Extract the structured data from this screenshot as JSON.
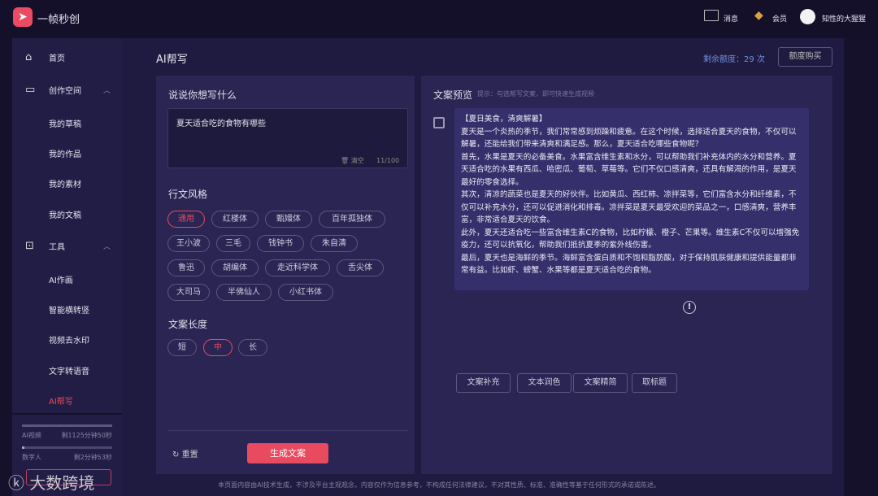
{
  "app": {
    "name": "一帧秒创",
    "logo_icon": "play-arrow-icon"
  },
  "topbar": {
    "messages": "消息",
    "member": "会员",
    "username": "知性的大猩猩"
  },
  "sidebar": {
    "items": [
      {
        "label": "首页"
      },
      {
        "label": "创作空间"
      },
      {
        "label": "我的草稿"
      },
      {
        "label": "我的作品"
      },
      {
        "label": "我的素材"
      },
      {
        "label": "我的文稿"
      },
      {
        "label": "工具"
      },
      {
        "label": "AI作画"
      },
      {
        "label": "智能横转竖"
      },
      {
        "label": "视频去水印"
      },
      {
        "label": "文字转语音"
      },
      {
        "label": "AI帮写"
      }
    ],
    "quota": [
      {
        "label": "AI视频",
        "value": "剩1125分钟50秒",
        "fill": 1.0
      },
      {
        "label": "数字人",
        "value": "剩2分钟53秒",
        "fill": 0.03
      }
    ]
  },
  "watermark": "大数跨境",
  "page": {
    "title": "AI帮写",
    "remaining": "剩余额度：29 次",
    "buy": "额度购买"
  },
  "left": {
    "prompt_title": "说说你想写什么",
    "prompt_value": "夏天适合吃的食物有哪些",
    "clear": "清空",
    "count": "11/100",
    "style_title": "行文风格",
    "styles": [
      "通用",
      "红楼体",
      "甄嬛体",
      "百年孤独体",
      "王小波",
      "三毛",
      "钱钟书",
      "朱自清",
      "鲁迅",
      "胡编体",
      "走近科学体",
      "舌尖体",
      "大司马",
      "半佛仙人",
      "小红书体"
    ],
    "length_title": "文案长度",
    "lengths": [
      "短",
      "中",
      "长"
    ],
    "reset": "重置",
    "generate": "生成文案"
  },
  "right": {
    "title": "文案预览",
    "hint": "提示：勾选帮写文案，即可快速生成视频",
    "content": "【夏日美食，清爽解暑】\n夏天是一个炎热的季节，我们常常感到烦躁和疲惫。在这个时候，选择适合夏天的食物，不仅可以解暑，还能给我们带来清爽和满足感。那么，夏天适合吃哪些食物呢？\n首先，水果是夏天的必备美食。水果富含维生素和水分，可以帮助我们补充体内的水分和营养。夏天适合吃的水果有西瓜、哈密瓜、葡萄、草莓等。它们不仅口感清爽，还具有解渴的作用，是夏天最好的零食选择。\n其次，清凉的蔬菜也是夏天的好伙伴。比如黄瓜、西红柿、凉拌菜等，它们富含水分和纤维素，不仅可以补充水分，还可以促进消化和排毒。凉拌菜是夏天最受欢迎的菜品之一，口感清爽，营养丰富，非常适合夏天的饮食。\n此外，夏天还适合吃一些富含维生素C的食物，比如柠檬、橙子、芒果等。维生素C不仅可以增强免疫力，还可以抗氧化，帮助我们抵抗夏季的紫外线伤害。\n最后，夏天也是海鲜的季节。海鲜富含蛋白质和不饱和脂肪酸，对于保持肌肤健康和提供能量都非常有益。比如虾、螃蟹、水果等都是夏天适合吃的食物。",
    "actions": [
      "文案补充",
      "文本润色",
      "文案精简",
      "取标题"
    ]
  },
  "footer": "本页面内容由AI技术生成，不涉及平台主观观念，内容仅作为信息参考，不构成任何法律建议，不对其性质、标准、准确性等基于任何形式的承诺或陈述。",
  "colors": {
    "accent": "#e84a5f",
    "link": "#6f8fe0"
  }
}
